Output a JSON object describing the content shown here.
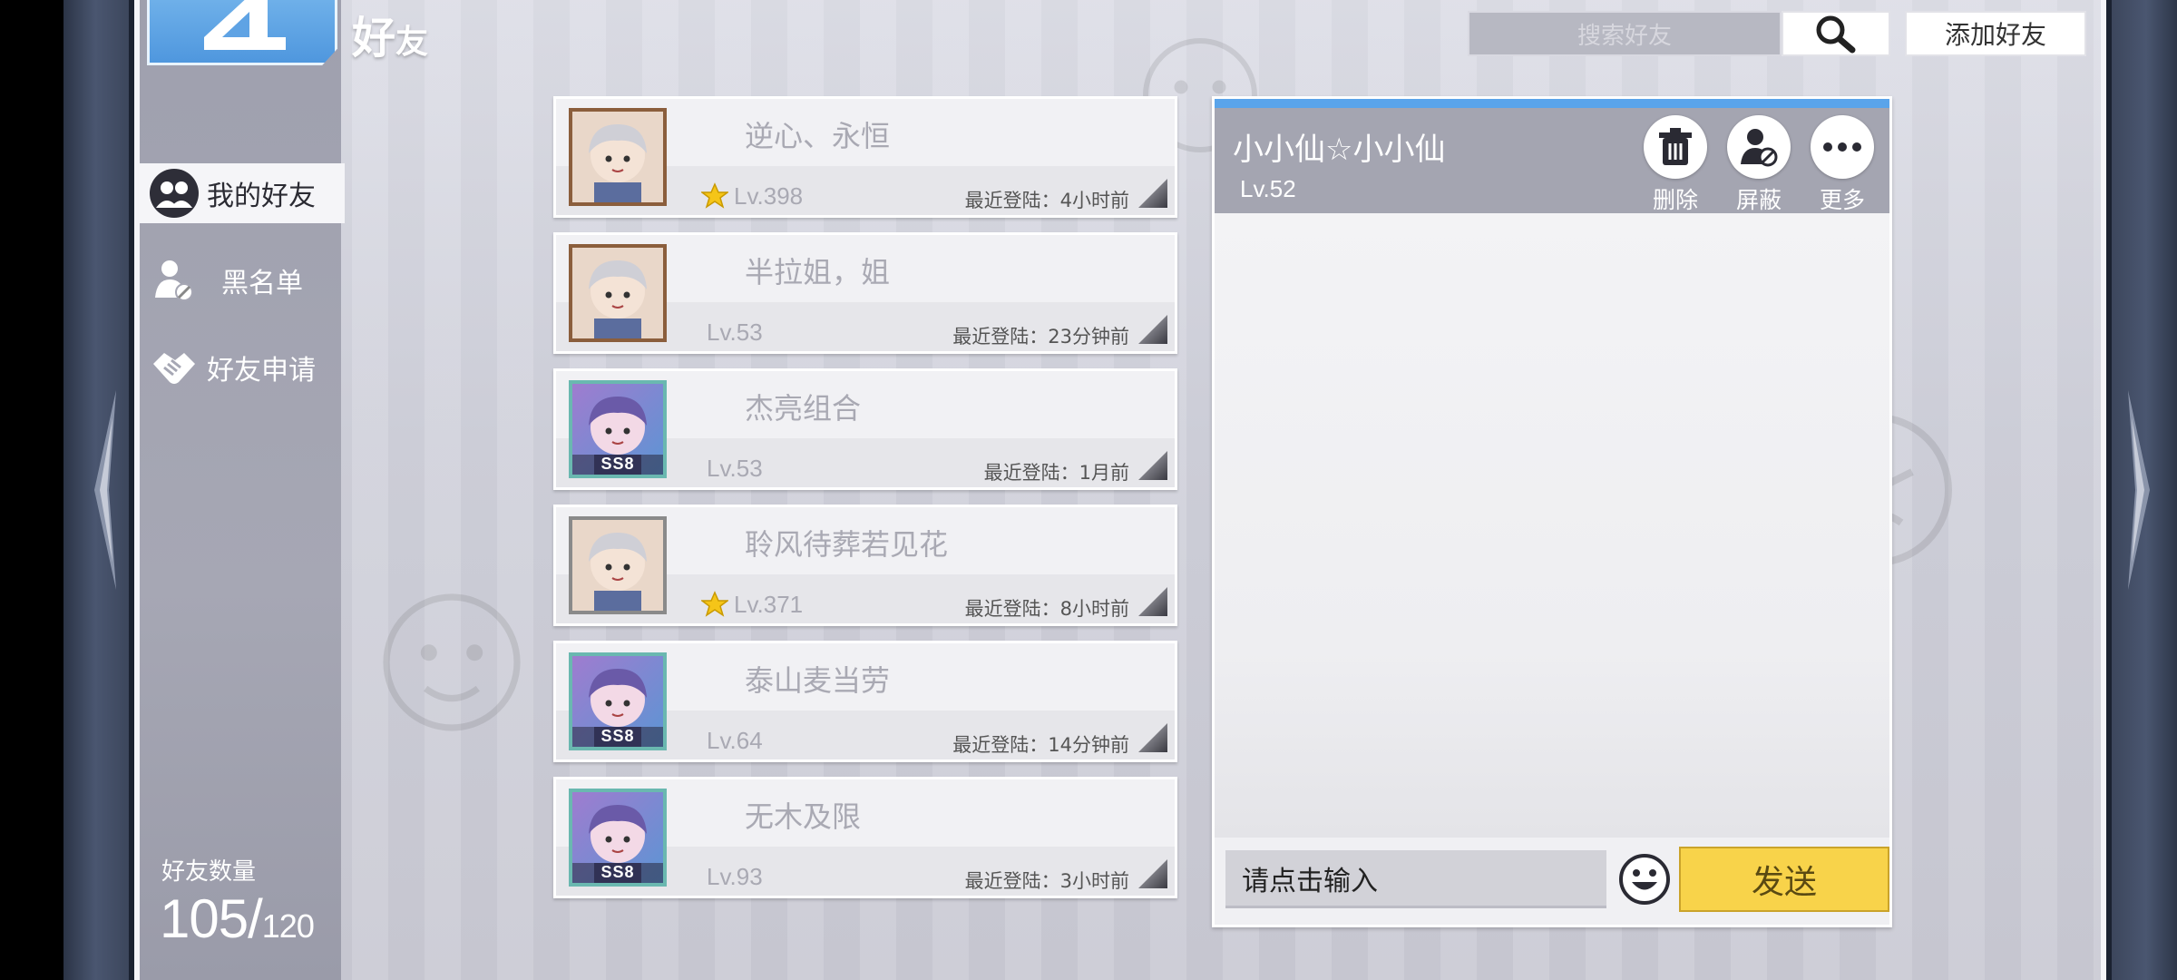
{
  "header": {
    "title_main": "好",
    "title_sub": "友",
    "search_placeholder": "搜索好友",
    "add_friend_label": "添加好友"
  },
  "sidebar": {
    "items": [
      {
        "label": "我的好友",
        "icon": "friends-icon",
        "active": true
      },
      {
        "label": "黑名单",
        "icon": "block-user-icon",
        "active": false
      },
      {
        "label": "好友申请",
        "icon": "handshake-icon",
        "active": false
      }
    ],
    "count_title": "好友数量",
    "count_current": "105/",
    "count_max": "120"
  },
  "friends": [
    {
      "name": "逆心、永恒",
      "level": "Lv.398",
      "starred": true,
      "last_login": "最近登陆：4小时前",
      "avatar_frame": "bronze",
      "ss8": false
    },
    {
      "name": "半拉姐，姐",
      "level": "Lv.53",
      "starred": false,
      "last_login": "最近登陆：23分钟前",
      "avatar_frame": "bronze",
      "ss8": false
    },
    {
      "name": "杰亮组合",
      "level": "Lv.53",
      "starred": false,
      "last_login": "最近登陆：1月前",
      "avatar_frame": "ss8",
      "ss8": true
    },
    {
      "name": "聆风待葬若见花",
      "level": "Lv.371",
      "starred": true,
      "last_login": "最近登陆：8小时前",
      "avatar_frame": "silver",
      "ss8": false
    },
    {
      "name": "泰山麦当劳",
      "level": "Lv.64",
      "starred": false,
      "last_login": "最近登陆：14分钟前",
      "avatar_frame": "ss8",
      "ss8": true
    },
    {
      "name": "无木及限",
      "level": "Lv.93",
      "starred": false,
      "last_login": "最近登陆：3小时前",
      "avatar_frame": "ss8",
      "ss8": true
    }
  ],
  "ss8_label": "SS8",
  "chat": {
    "name": "小小仙☆小小仙",
    "level": "Lv.52",
    "actions": [
      {
        "label": "删除",
        "icon": "trash-icon"
      },
      {
        "label": "屏蔽",
        "icon": "block-user-icon"
      },
      {
        "label": "更多",
        "icon": "more-icon"
      }
    ],
    "input_placeholder": "请点击输入",
    "send_label": "发送"
  },
  "colors": {
    "accent_blue": "#5aa4ea",
    "send_yellow": "#f8d34a",
    "star_yellow": "#f5c518"
  }
}
